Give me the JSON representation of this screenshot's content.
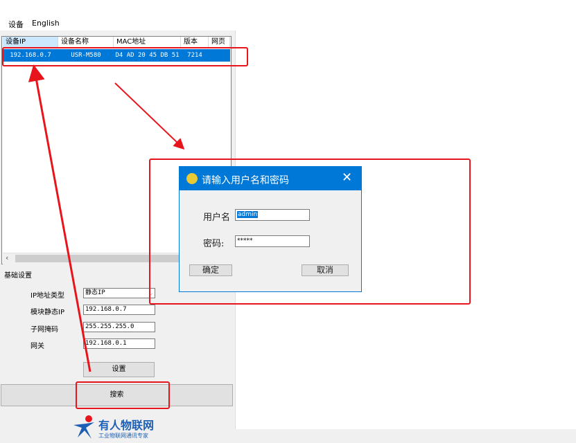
{
  "menu": {
    "items": [
      "设备",
      "English"
    ]
  },
  "table": {
    "headers": [
      "设备IP",
      "设备名称",
      "MAC地址",
      "版本",
      "网页"
    ],
    "rows": [
      {
        "ip": "192.168.0.7",
        "name": "USR-M580",
        "mac": "D4 AD 20 45 DB 51",
        "version": "7214",
        "web": ""
      }
    ]
  },
  "basic": {
    "title": "基础设置",
    "ip_type_label": "IP地址类型",
    "ip_type_value": "静态IP",
    "static_ip_label": "模块静态IP",
    "static_ip_value": "192.168.0.7",
    "subnet_label": "子网掩码",
    "subnet_value": "255.255.255.0",
    "gateway_label": "网关",
    "gateway_value": "192.168.0.1",
    "set_button": "设置",
    "search_button": "搜索"
  },
  "dialog": {
    "title": "请输入用户名和密码",
    "username_label": "用户名",
    "username_value": "admin",
    "password_label": "密码:",
    "password_value": "*****",
    "ok_button": "确定",
    "cancel_button": "取消"
  },
  "brand": {
    "name": "有人物联网",
    "tagline": "工业物联网通讯专家"
  },
  "colors": {
    "selection": "#0078d7",
    "annotation": "#e8141c",
    "brand": "#1d5fb4"
  }
}
